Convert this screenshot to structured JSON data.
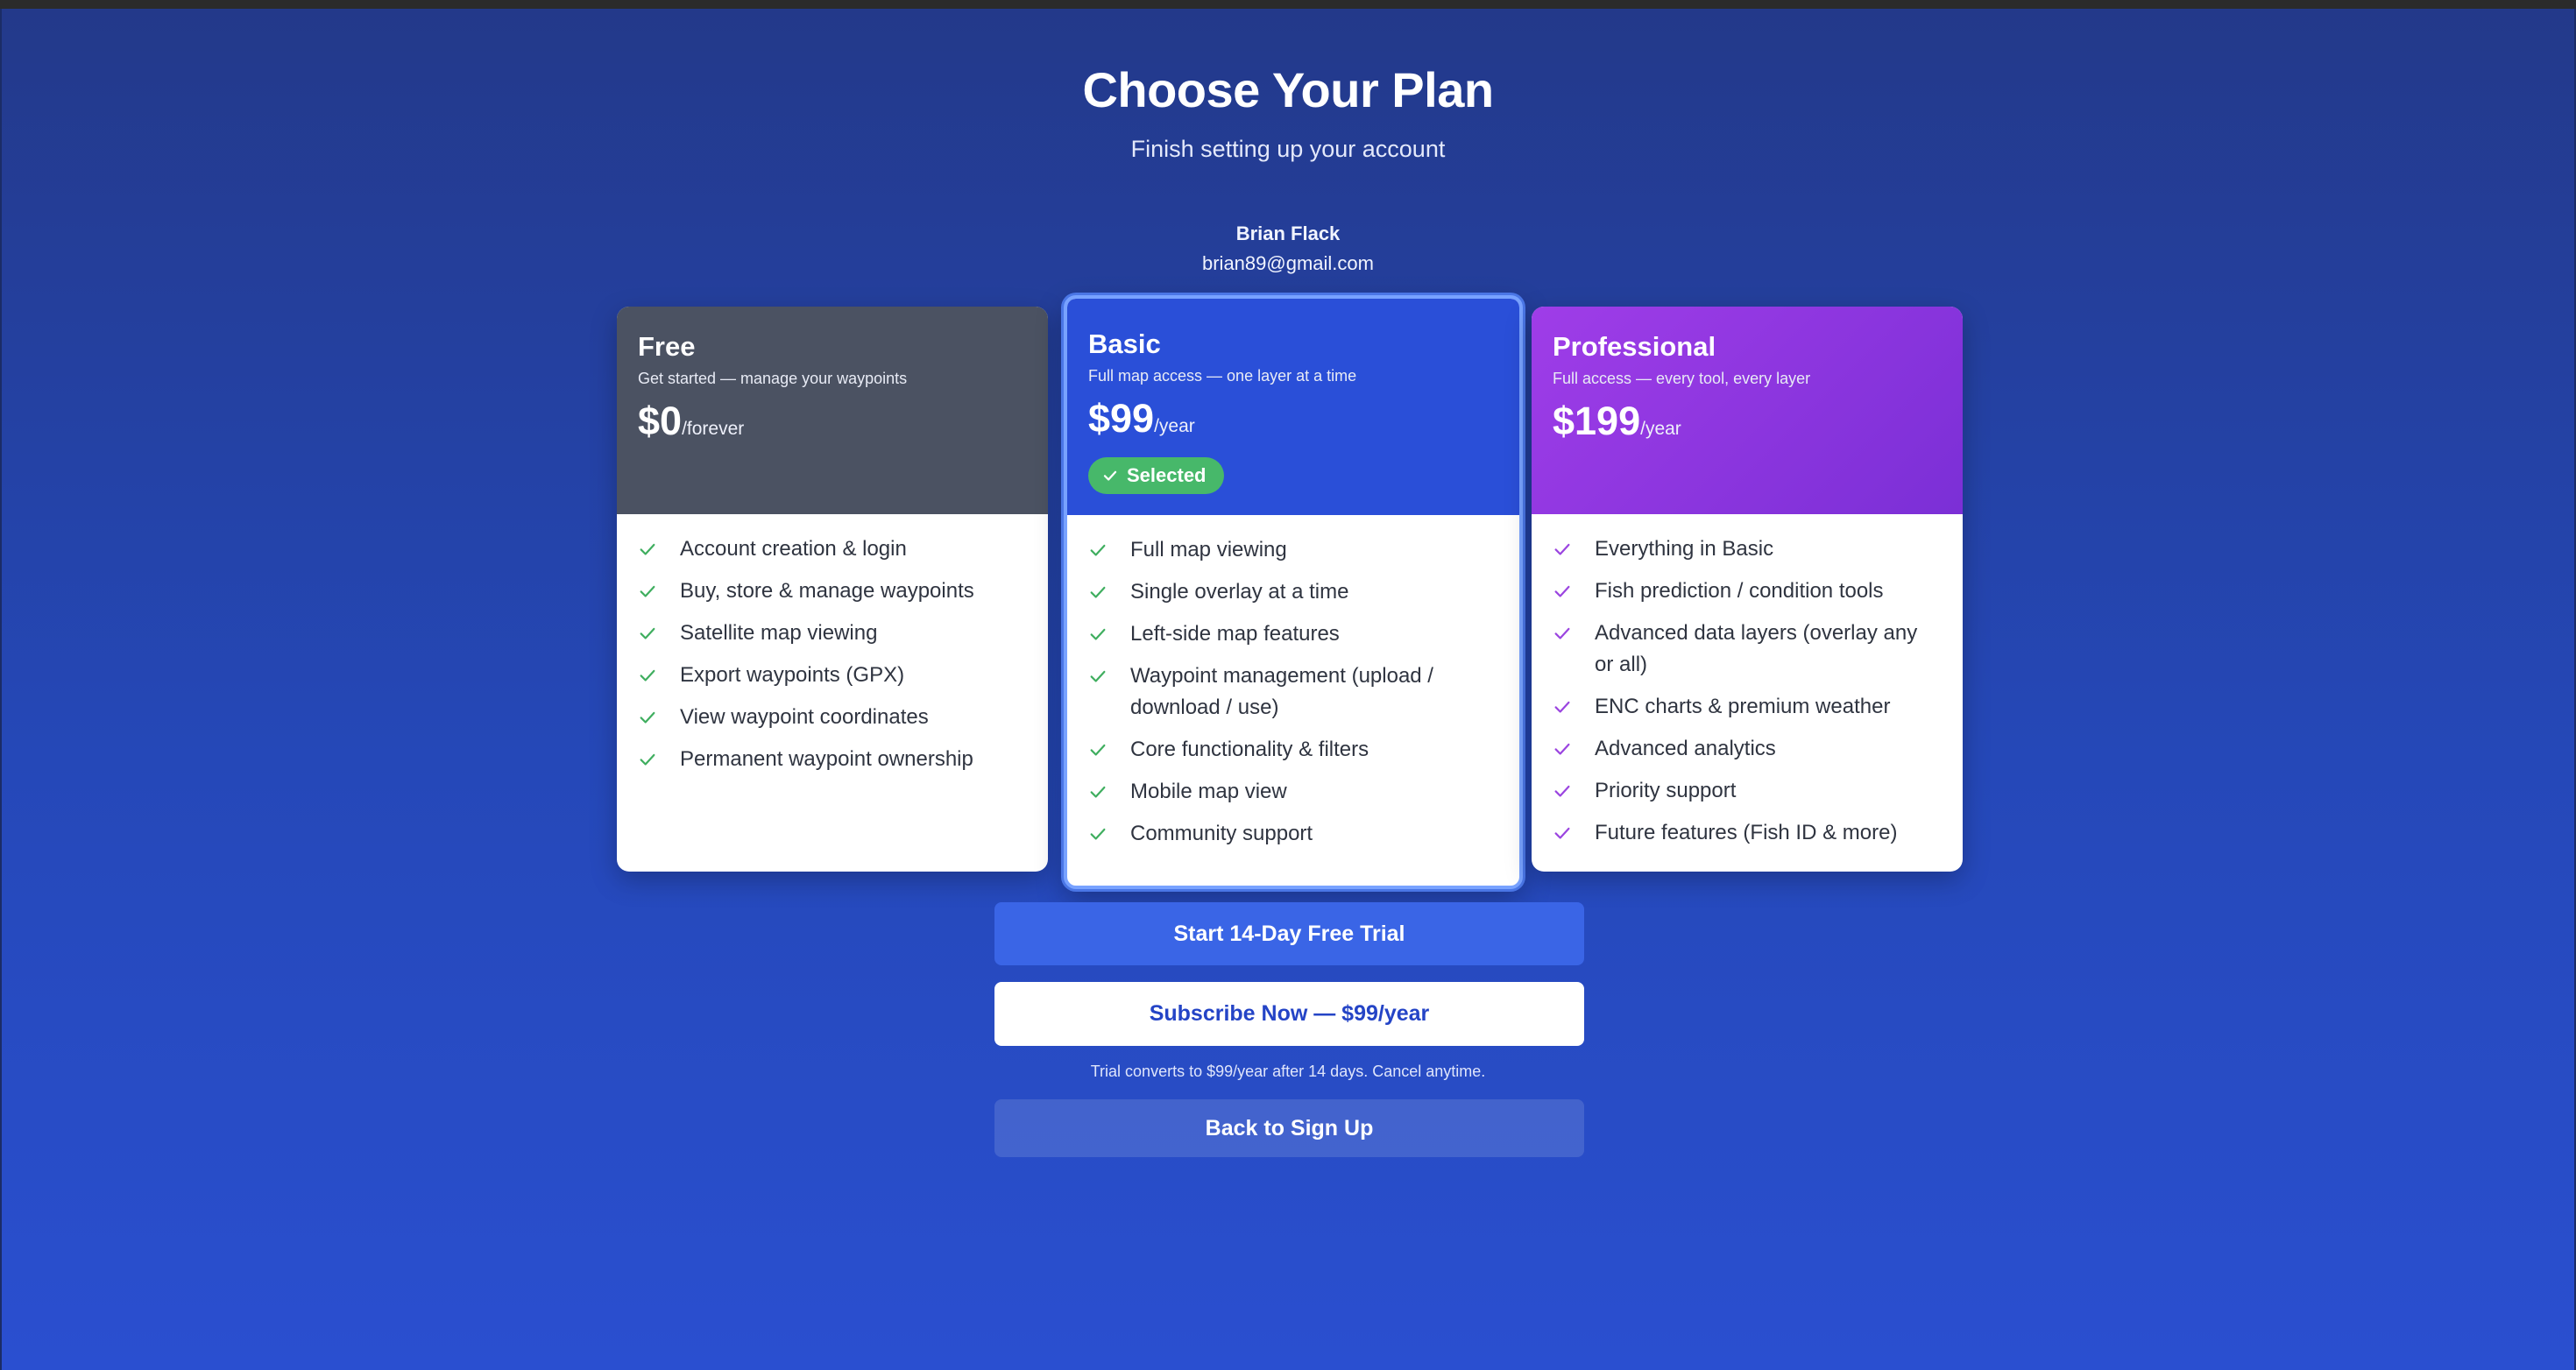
{
  "header": {
    "title": "Choose Your Plan",
    "subtitle": "Finish setting up your account"
  },
  "user": {
    "name": "Brian Flack",
    "email": "brian89@gmail.com"
  },
  "plans": [
    {
      "name": "Free",
      "description": "Get started — manage your waypoints",
      "price": "$0",
      "period": "/forever",
      "header_color": "#4b5262",
      "check_color": "#3fae5f",
      "features": [
        "Account creation & login",
        "Buy, store & manage waypoints",
        "Satellite map viewing",
        "Export waypoints (GPX)",
        "View waypoint coordinates",
        "Permanent waypoint ownership"
      ]
    },
    {
      "name": "Basic",
      "description": "Full map access — one layer at a time",
      "price": "$99",
      "period": "/year",
      "badge": "Selected",
      "selected": true,
      "header_color": "#2a4fd8",
      "check_color": "#3fae5f",
      "features": [
        "Full map viewing",
        "Single overlay at a time",
        "Left-side map features",
        "Waypoint management (upload / download / use)",
        "Core functionality & filters",
        "Mobile map view",
        "Community support"
      ]
    },
    {
      "name": "Professional",
      "description": "Full access — every tool, every layer",
      "price": "$199",
      "period": "/year",
      "header_color": "#8a35e0",
      "check_color": "#9b45e0",
      "features": [
        "Everything in Basic",
        "Fish prediction / condition tools",
        "Advanced data layers (overlay any or all)",
        "ENC charts & premium weather",
        "Advanced analytics",
        "Priority support",
        "Future features (Fish ID & more)"
      ]
    }
  ],
  "actions": {
    "trial_label": "Start 14-Day Free Trial",
    "subscribe_label": "Subscribe Now — $99/year",
    "note": "Trial converts to $99/year after 14 days. Cancel anytime.",
    "back_label": "Back to Sign Up"
  },
  "colors": {
    "background_top": "#23398a",
    "background_bottom": "#2a4fd0",
    "primary_button": "#3a65e6",
    "badge_green": "#47b86a"
  }
}
